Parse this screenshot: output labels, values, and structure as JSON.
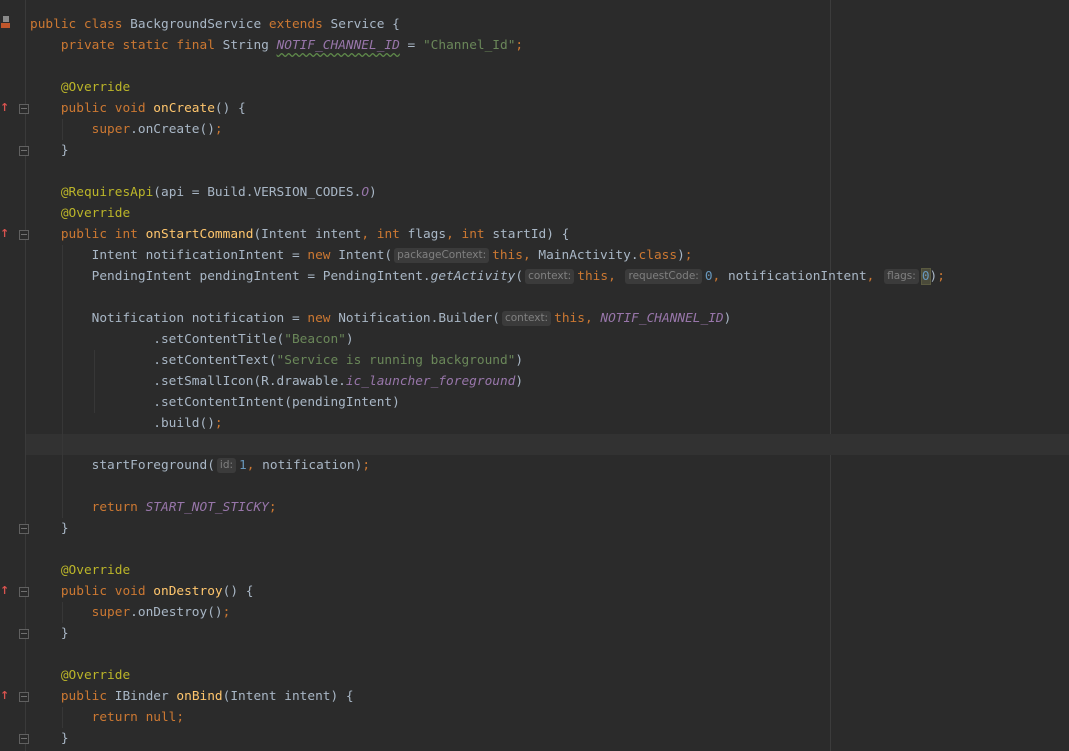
{
  "editor": {
    "lines": [
      {
        "n": 0,
        "tokens": [
          {
            "t": "public class ",
            "c": "kw"
          },
          {
            "t": "BackgroundService "
          },
          {
            "t": "extends ",
            "c": "kw"
          },
          {
            "t": "Service {"
          }
        ]
      },
      {
        "n": 1,
        "tokens": [
          {
            "t": "    "
          },
          {
            "t": "private static final ",
            "c": "kw"
          },
          {
            "t": "String "
          },
          {
            "t": "NOTIF_CHANNEL_ID",
            "c": "sf wv"
          },
          {
            "t": " = "
          },
          {
            "t": "\"Channel_Id\"",
            "c": "st"
          },
          {
            "t": ";",
            "c": "kw"
          }
        ]
      },
      {
        "n": 3,
        "tokens": [
          {
            "t": "    "
          },
          {
            "t": "@Override",
            "c": "an"
          }
        ]
      },
      {
        "n": 4,
        "tokens": [
          {
            "t": "    "
          },
          {
            "t": "public void ",
            "c": "kw"
          },
          {
            "t": "onCreate",
            "c": "md"
          },
          {
            "t": "() {"
          }
        ]
      },
      {
        "n": 5,
        "tokens": [
          {
            "t": "        "
          },
          {
            "t": "super",
            "c": "kw"
          },
          {
            "t": ".onCreate()"
          },
          {
            "t": ";",
            "c": "kw"
          }
        ]
      },
      {
        "n": 6,
        "tokens": [
          {
            "t": "    }"
          }
        ]
      },
      {
        "n": 8,
        "tokens": [
          {
            "t": "    "
          },
          {
            "t": "@RequiresApi",
            "c": "an"
          },
          {
            "t": "(api = Build.VERSION_CODES."
          },
          {
            "t": "O",
            "c": "sf"
          },
          {
            "t": ")"
          }
        ]
      },
      {
        "n": 9,
        "tokens": [
          {
            "t": "    "
          },
          {
            "t": "@Override",
            "c": "an"
          }
        ]
      },
      {
        "n": 10,
        "tokens": [
          {
            "t": "    "
          },
          {
            "t": "public int ",
            "c": "kw"
          },
          {
            "t": "onStartCommand",
            "c": "md"
          },
          {
            "t": "(Intent intent"
          },
          {
            "t": ", int ",
            "c": "kw"
          },
          {
            "t": "flags"
          },
          {
            "t": ", int ",
            "c": "kw"
          },
          {
            "t": "startId) {"
          }
        ]
      },
      {
        "n": 11,
        "tokens": [
          {
            "t": "        Intent notificationIntent = "
          },
          {
            "t": "new ",
            "c": "kw"
          },
          {
            "t": "Intent("
          },
          {
            "t": "packageContext:",
            "c": "hint"
          },
          {
            "t": "this",
            "c": "kw"
          },
          {
            "t": ", ",
            "c": "kw"
          },
          {
            "t": "MainActivity."
          },
          {
            "t": "class",
            "c": "kw"
          },
          {
            "t": ")"
          },
          {
            "t": ";",
            "c": "kw"
          }
        ]
      },
      {
        "n": 12,
        "tokens": [
          {
            "t": "        PendingIntent pendingIntent = PendingIntent."
          },
          {
            "t": "getActivity",
            "c": "it"
          },
          {
            "t": "("
          },
          {
            "t": "context:",
            "c": "hint"
          },
          {
            "t": "this",
            "c": "kw"
          },
          {
            "t": ", ",
            "c": "kw"
          },
          {
            "t": "requestCode:",
            "c": "hint"
          },
          {
            "t": "0",
            "c": "nm"
          },
          {
            "t": ", ",
            "c": "kw"
          },
          {
            "t": "notificationIntent"
          },
          {
            "t": ", ",
            "c": "kw"
          },
          {
            "t": "flags:",
            "c": "hint"
          },
          {
            "t": "0",
            "c": "nm hl"
          },
          {
            "t": ")"
          },
          {
            "t": ";",
            "c": "kw"
          }
        ]
      },
      {
        "n": 14,
        "tokens": [
          {
            "t": "        Notification notification = "
          },
          {
            "t": "new ",
            "c": "kw"
          },
          {
            "t": "Notification.Builder("
          },
          {
            "t": "context:",
            "c": "hint"
          },
          {
            "t": "this",
            "c": "kw"
          },
          {
            "t": ", ",
            "c": "kw"
          },
          {
            "t": "NOTIF_CHANNEL_ID",
            "c": "sf"
          },
          {
            "t": ")"
          }
        ]
      },
      {
        "n": 15,
        "tokens": [
          {
            "t": "                .setContentTitle("
          },
          {
            "t": "\"Beacon\"",
            "c": "st"
          },
          {
            "t": ")"
          }
        ]
      },
      {
        "n": 16,
        "tokens": [
          {
            "t": "                .setContentText("
          },
          {
            "t": "\"Service is running background\"",
            "c": "st"
          },
          {
            "t": ")"
          }
        ]
      },
      {
        "n": 17,
        "tokens": [
          {
            "t": "                .setSmallIcon(R.drawable."
          },
          {
            "t": "ic_launcher_foreground",
            "c": "sf"
          },
          {
            "t": ")"
          }
        ]
      },
      {
        "n": 18,
        "tokens": [
          {
            "t": "                .setContentIntent(pendingIntent)"
          }
        ]
      },
      {
        "n": 19,
        "tokens": [
          {
            "t": "                .build()"
          },
          {
            "t": ";",
            "c": "kw"
          }
        ]
      },
      {
        "n": 21,
        "tokens": [
          {
            "t": "        startForeground("
          },
          {
            "t": "id:",
            "c": "hint"
          },
          {
            "t": "1",
            "c": "nm"
          },
          {
            "t": ", ",
            "c": "kw"
          },
          {
            "t": "notification)"
          },
          {
            "t": ";",
            "c": "kw"
          }
        ]
      },
      {
        "n": 23,
        "tokens": [
          {
            "t": "        "
          },
          {
            "t": "return ",
            "c": "kw"
          },
          {
            "t": "START_NOT_STICKY",
            "c": "sf"
          },
          {
            "t": ";",
            "c": "kw"
          }
        ]
      },
      {
        "n": 24,
        "tokens": [
          {
            "t": "    }"
          }
        ]
      },
      {
        "n": 26,
        "tokens": [
          {
            "t": "    "
          },
          {
            "t": "@Override",
            "c": "an"
          }
        ]
      },
      {
        "n": 27,
        "tokens": [
          {
            "t": "    "
          },
          {
            "t": "public void ",
            "c": "kw"
          },
          {
            "t": "onDestroy",
            "c": "md"
          },
          {
            "t": "() {"
          }
        ]
      },
      {
        "n": 28,
        "tokens": [
          {
            "t": "        "
          },
          {
            "t": "super",
            "c": "kw"
          },
          {
            "t": ".onDestroy()"
          },
          {
            "t": ";",
            "c": "kw"
          }
        ]
      },
      {
        "n": 29,
        "tokens": [
          {
            "t": "    }"
          }
        ]
      },
      {
        "n": 31,
        "tokens": [
          {
            "t": "    "
          },
          {
            "t": "@Override",
            "c": "an"
          }
        ]
      },
      {
        "n": 32,
        "tokens": [
          {
            "t": "    "
          },
          {
            "t": "public ",
            "c": "kw"
          },
          {
            "t": "IBinder "
          },
          {
            "t": "onBind",
            "c": "md"
          },
          {
            "t": "(Intent intent) {"
          }
        ]
      },
      {
        "n": 33,
        "tokens": [
          {
            "t": "        "
          },
          {
            "t": "return null",
            "c": "kw"
          },
          {
            "t": ";",
            "c": "kw"
          }
        ]
      },
      {
        "n": 34,
        "tokens": [
          {
            "t": "    }"
          }
        ]
      }
    ],
    "current_line": 20,
    "override_lines": [
      4,
      10,
      27,
      32
    ],
    "fold_lines": [
      4,
      6,
      10,
      24,
      27,
      29,
      32,
      34
    ],
    "override_icon": "↑"
  }
}
